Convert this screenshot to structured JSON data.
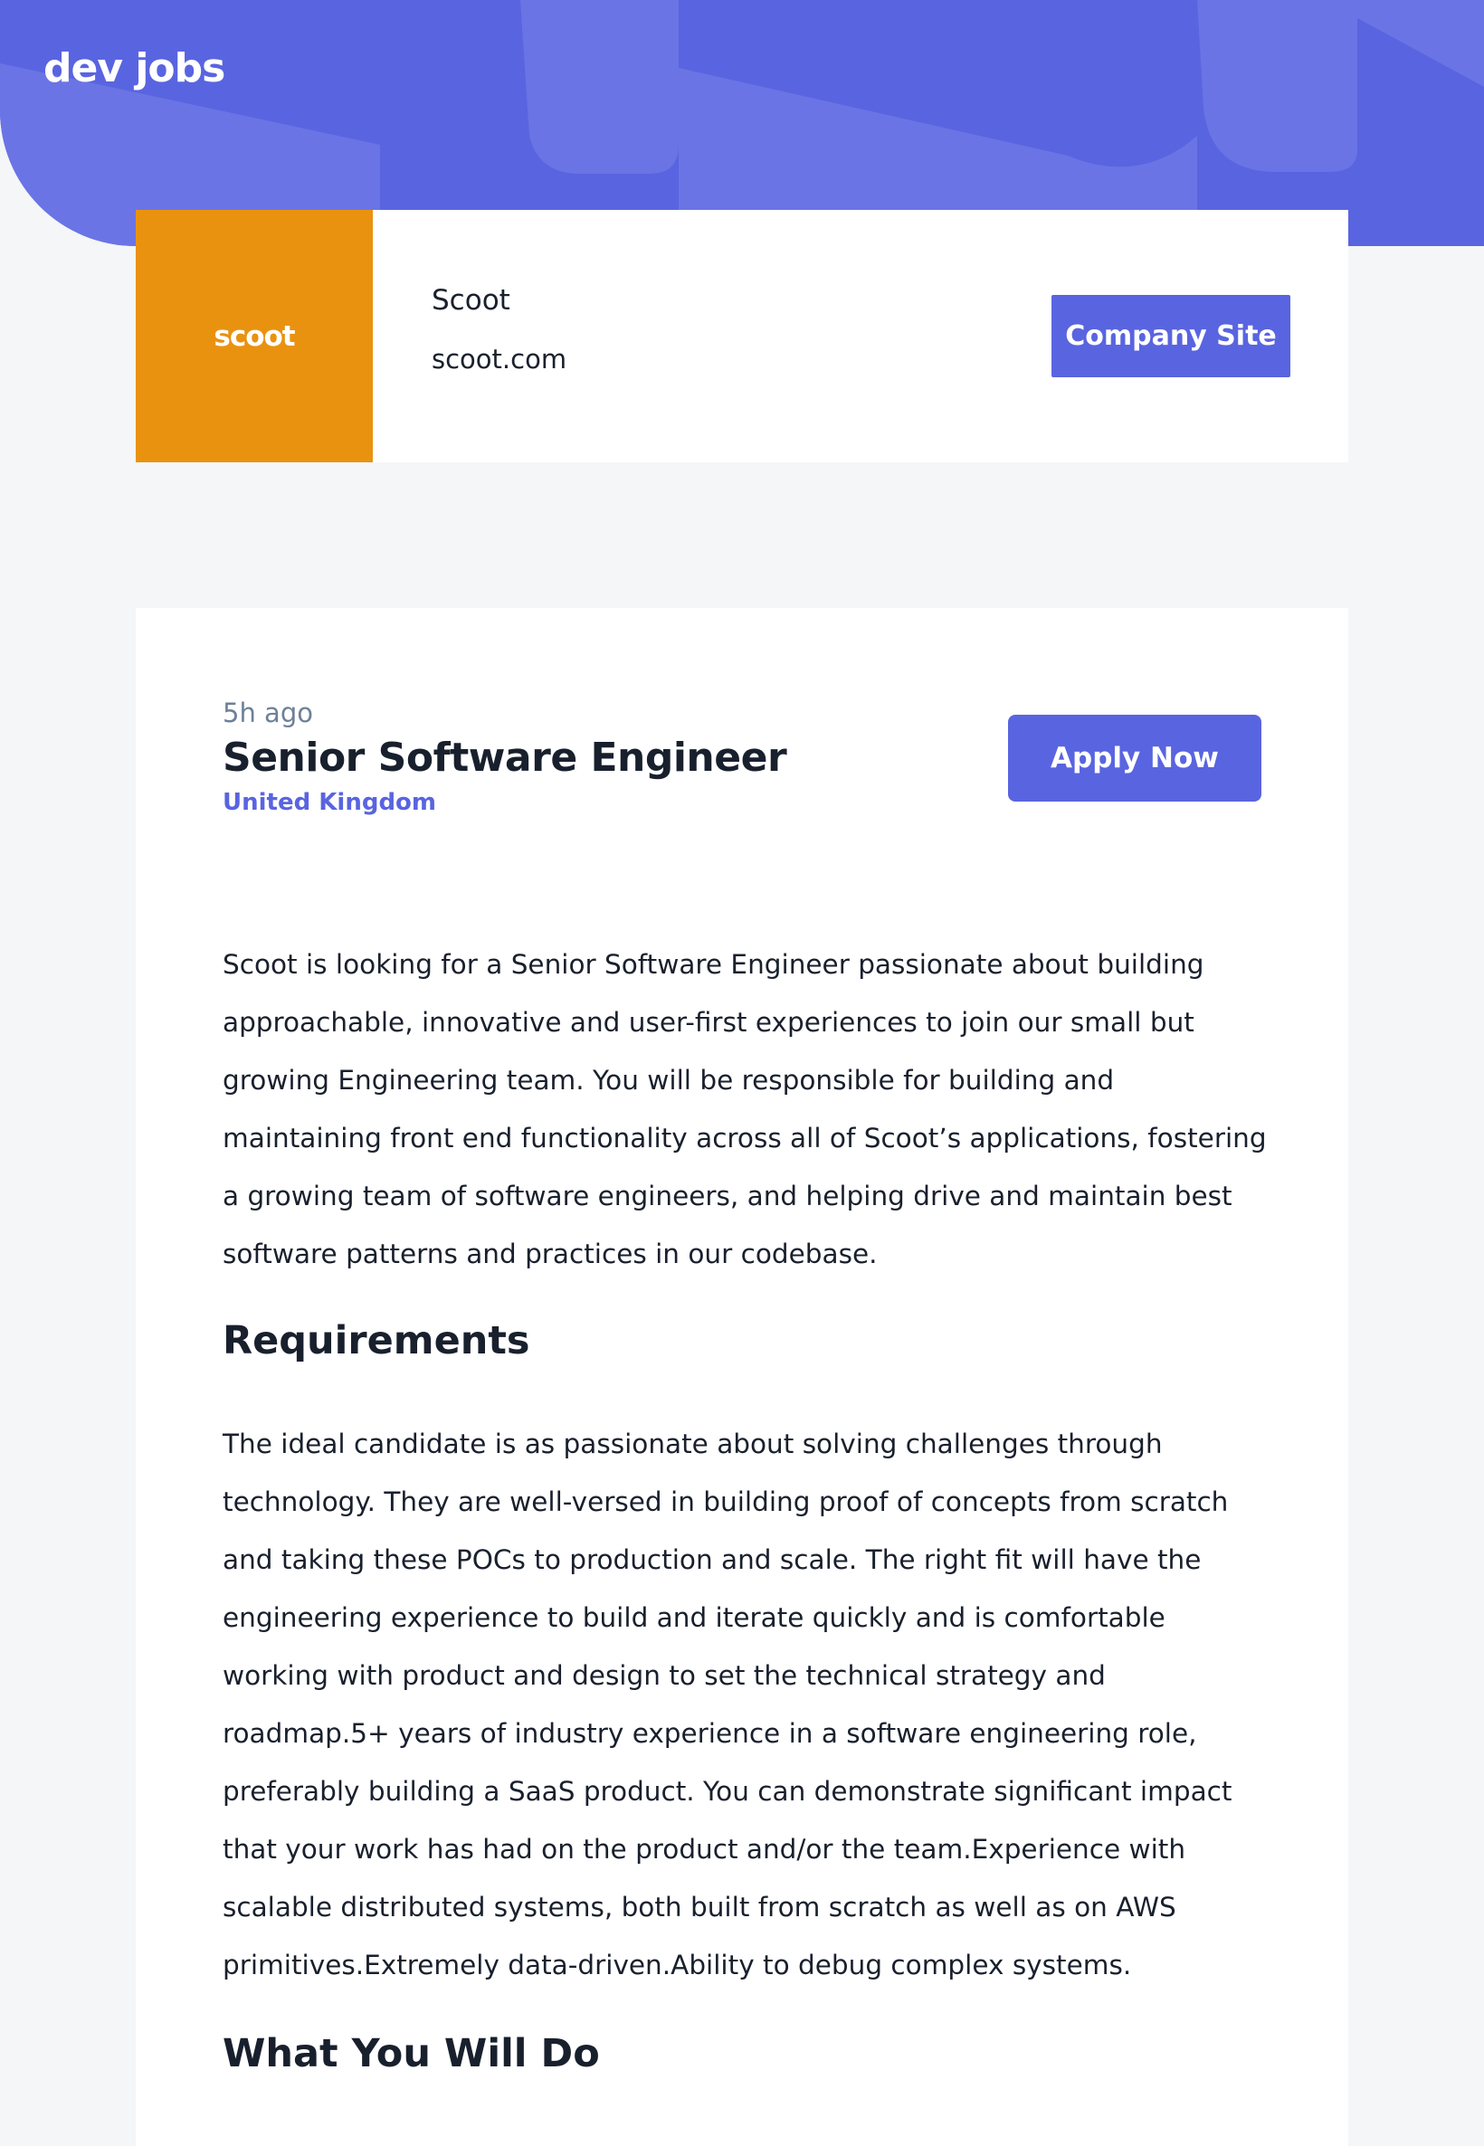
{
  "header": {
    "logo": "dev jobs"
  },
  "company": {
    "logo_text": "scoot",
    "logo_color": "#E99210",
    "name": "Scoot",
    "url": "scoot.com",
    "site_button_label": "Company Site"
  },
  "job": {
    "posted": "5h ago",
    "title": "Senior Software Engineer",
    "location": "United Kingdom",
    "apply_label": "Apply Now",
    "description": "Scoot is looking for a Senior Software Engineer passionate about building approachable, innovative and user-first experiences to join our small but growing Engineering team. You will be responsible for building and maintaining front end functionality across all of Scoot’s applications, fostering a growing team of software engineers, and helping drive and maintain best software patterns and practices in our codebase.",
    "requirements_title": "Requirements",
    "requirements_text": "The ideal candidate is as passionate about solving challenges through technology. They are well-versed in building proof of concepts from scratch and taking these POCs to production and scale. The right fit will have the engineering experience to build and iterate quickly and is comfortable working with product and design to set the technical strategy and roadmap.5+ years of industry experience in a software engineering role, preferably building a SaaS product. You can demonstrate significant impact that your work has had on the product and/or the team.Experience with scalable distributed systems, both built from scratch as well as on AWS primitives.Extremely data-driven.Ability to debug complex systems.",
    "what_you_will_do_title": "What You Will Do"
  },
  "colors": {
    "accent": "#5964E0",
    "background": "#F4F6F8",
    "text": "#19202D",
    "muted": "#6E8098"
  }
}
